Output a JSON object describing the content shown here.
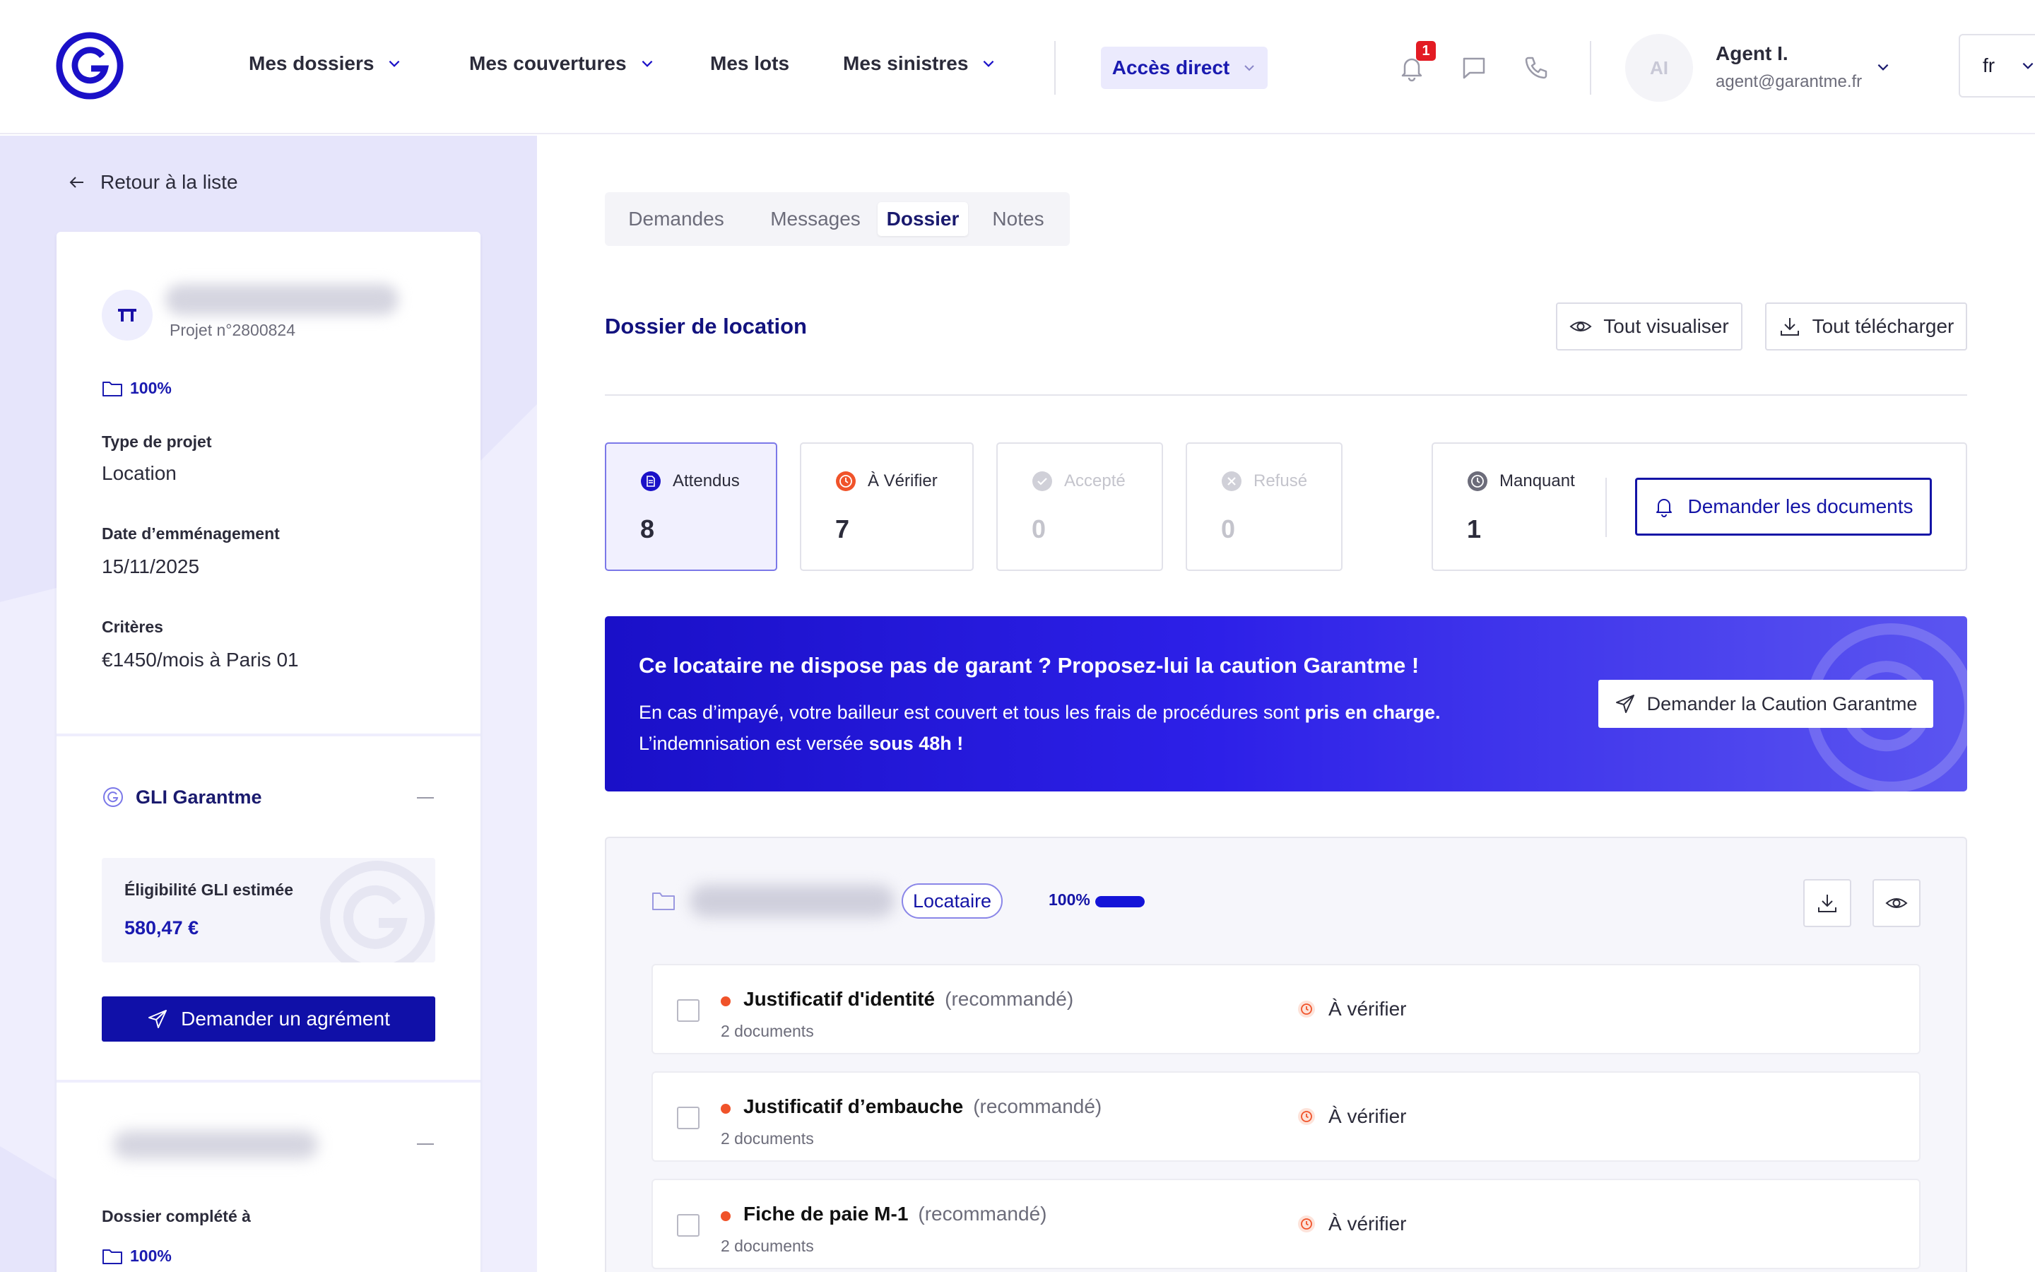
{
  "header": {
    "nav": [
      {
        "label": "Mes dossiers"
      },
      {
        "label": "Mes couvertures"
      },
      {
        "label": "Mes lots"
      },
      {
        "label": "Mes sinistres"
      }
    ],
    "direct_label": "Accès direct",
    "notification_count": "1",
    "user": {
      "initials": "AI",
      "name": "Agent I.",
      "email": "agent@garantme.fr"
    },
    "language": "fr"
  },
  "sidebar": {
    "back_label": "Retour à la liste",
    "project_number": "Projet n°2800824",
    "completion": "100%",
    "fields": [
      {
        "label": "Type de projet",
        "value": "Location"
      },
      {
        "label": "Date d’emménagement",
        "value": "15/11/2025"
      },
      {
        "label": "Critères",
        "value": "€1450/mois à Paris 01"
      }
    ],
    "gli": {
      "title": "GLI Garantme",
      "eligibility_label": "Éligibilité GLI estimée",
      "eligibility_value": "580,47 €",
      "button_label": "Demander un agrément"
    },
    "section3": {
      "label": "Dossier complété à",
      "completion": "100%"
    }
  },
  "main": {
    "tabs": [
      {
        "label": "Demandes"
      },
      {
        "label": "Messages"
      },
      {
        "label": "Dossier"
      },
      {
        "label": "Notes"
      }
    ],
    "active_tab": "Dossier",
    "title": "Dossier de location",
    "view_all_label": "Tout visualiser",
    "download_all_label": "Tout télécharger",
    "stats": [
      {
        "label": "Attendus",
        "value": "8"
      },
      {
        "label": "À Vérifier",
        "value": "7"
      },
      {
        "label": "Accepté",
        "value": "0"
      },
      {
        "label": "Refusé",
        "value": "0"
      },
      {
        "label": "Manquant",
        "value": "1"
      }
    ],
    "request_docs_label": "Demander les documents",
    "banner": {
      "title": "Ce locataire ne dispose pas de garant ? Proposez-lui la caution Garantme !",
      "line1_start": "En cas d’impayé, votre bailleur est couvert et tous les frais de procédures sont ",
      "line1_bold": "pris en charge.",
      "line2_start": "L’indemnisation est versée ",
      "line2_bold": "sous 48h !",
      "button_label": "Demander la Caution Garantme"
    },
    "tenant": {
      "role_badge": "Locataire",
      "completion_label": "100%",
      "completion": 1.0
    },
    "documents": [
      {
        "title": "Justificatif d'identité",
        "tag": "(recommandé)",
        "count": "2 documents",
        "status": "À vérifier"
      },
      {
        "title": "Justificatif d’embauche",
        "tag": "(recommandé)",
        "count": "2 documents",
        "status": "À vérifier"
      },
      {
        "title": "Fiche de paie M-1",
        "tag": "(recommandé)",
        "count": "2 documents",
        "status": "À vérifier"
      }
    ]
  },
  "colors": {
    "brand": "#1010a8",
    "accent_light": "#efeefd",
    "status_orange": "#f0532a"
  }
}
